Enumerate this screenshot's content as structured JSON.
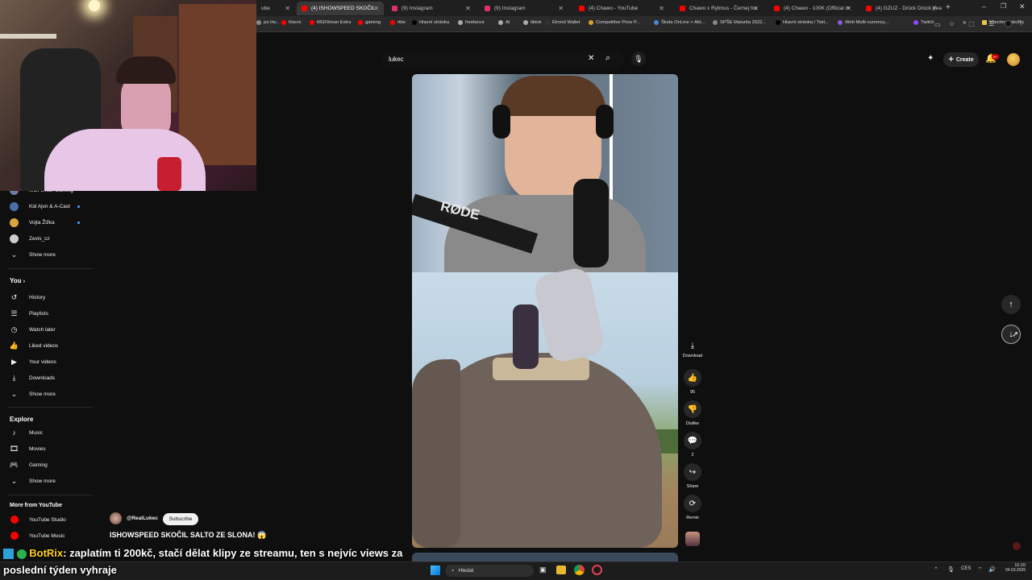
{
  "browser": {
    "tabs": [
      {
        "label": "ube",
        "fav": "#ff0000"
      },
      {
        "label": "(4) ISHOWSPEED SKOČIL",
        "fav": "#ff0000",
        "active": true
      },
      {
        "label": "(9) Instagram",
        "fav": "#e1306c"
      },
      {
        "label": "(9) Instagram",
        "fav": "#e1306c"
      },
      {
        "label": "(4) Chawo - YouTube",
        "fav": "#ff0000"
      },
      {
        "label": "Chawo x Rytmus - Černej tro",
        "fav": "#ff0000"
      },
      {
        "label": "(4) Chawo - 100K (Official m",
        "fav": "#ff0000"
      },
      {
        "label": "(4) GZUZ - Drück Drück (feat",
        "fav": "#ff0000"
      }
    ],
    "new_tab": "+",
    "bookmarks": [
      "ps://w...",
      "hlavni",
      "MGFitman Extra",
      "gaming",
      "rtbe",
      "Hlavní stránka",
      "freelance",
      "AI",
      "tiktok",
      "Elrond Wallet",
      "Competitive Prize P...",
      "Škola OnLine > Akt...",
      "SPŠE Maturita 2022...",
      "Hlavní stránka / Twit...",
      "Web Multi-currency...",
      "Twitch"
    ],
    "bookmarks_more": "»",
    "all_bookmarks": "Všechny záložky"
  },
  "sidebar": {
    "subscriptions": [
      {
        "label": "MGFitman Gaming",
        "avatar": "#6a7fa0"
      },
      {
        "label": "Kid Ajvn & A-Cast",
        "avatar": "#4a6fa8",
        "dot": true
      },
      {
        "label": "Vojta Žižka",
        "avatar": "#d8a640",
        "dot": true
      },
      {
        "label": "Zevis_cz",
        "avatar": "#cccccc"
      }
    ],
    "show_more_1": "Show more",
    "you_heading": "You",
    "you_items": [
      {
        "label": "History",
        "icon": "history-icon",
        "glyph": "↺"
      },
      {
        "label": "Playlists",
        "icon": "playlists-icon",
        "glyph": "☰"
      },
      {
        "label": "Watch later",
        "icon": "clock-icon",
        "glyph": "◷"
      },
      {
        "label": "Liked videos",
        "icon": "thumbs-up-icon",
        "glyph": "👍"
      },
      {
        "label": "Your videos",
        "icon": "video-icon",
        "glyph": "▶"
      },
      {
        "label": "Downloads",
        "icon": "download-icon",
        "glyph": "⤓"
      }
    ],
    "show_more_2": "Show more",
    "explore_heading": "Explore",
    "explore_items": [
      {
        "label": "Music",
        "icon": "music-icon",
        "glyph": "♪"
      },
      {
        "label": "Movies",
        "icon": "movies-icon",
        "glyph": "🎞"
      },
      {
        "label": "Gaming",
        "icon": "gaming-icon",
        "glyph": "🎮"
      }
    ],
    "show_more_3": "Show more",
    "more_heading": "More from YouTube",
    "more_items": [
      {
        "label": "YouTube Studio"
      },
      {
        "label": "YouTube Music"
      }
    ]
  },
  "search": {
    "query": "lukec"
  },
  "topbar": {
    "create_label": "Create",
    "notif_badge": "9+"
  },
  "short": {
    "download_label": "Download",
    "likes": "95",
    "dislike_label": "Dislike",
    "comments": "2",
    "share_label": "Share",
    "remix_label": "Remix",
    "channel": "@RealLukec",
    "subscribe_label": "Subscribe",
    "title": "ISHOWSPEED SKOČIL SALTO ZE SLONA! 😱"
  },
  "chat": {
    "user": "BotRix",
    "message_line1": ": zaplatím ti 200kč, stačí dělat klipy ze streamu, ten s nejvíc views za",
    "message_line2": "poslední týden vyhraje"
  },
  "taskbar": {
    "search_placeholder": "Hledat",
    "lang": "CES",
    "time": "16:20",
    "date": "04.03.2026"
  },
  "colors": {
    "accent_red": "#ff0000",
    "chat_user": "#ffd21e"
  }
}
